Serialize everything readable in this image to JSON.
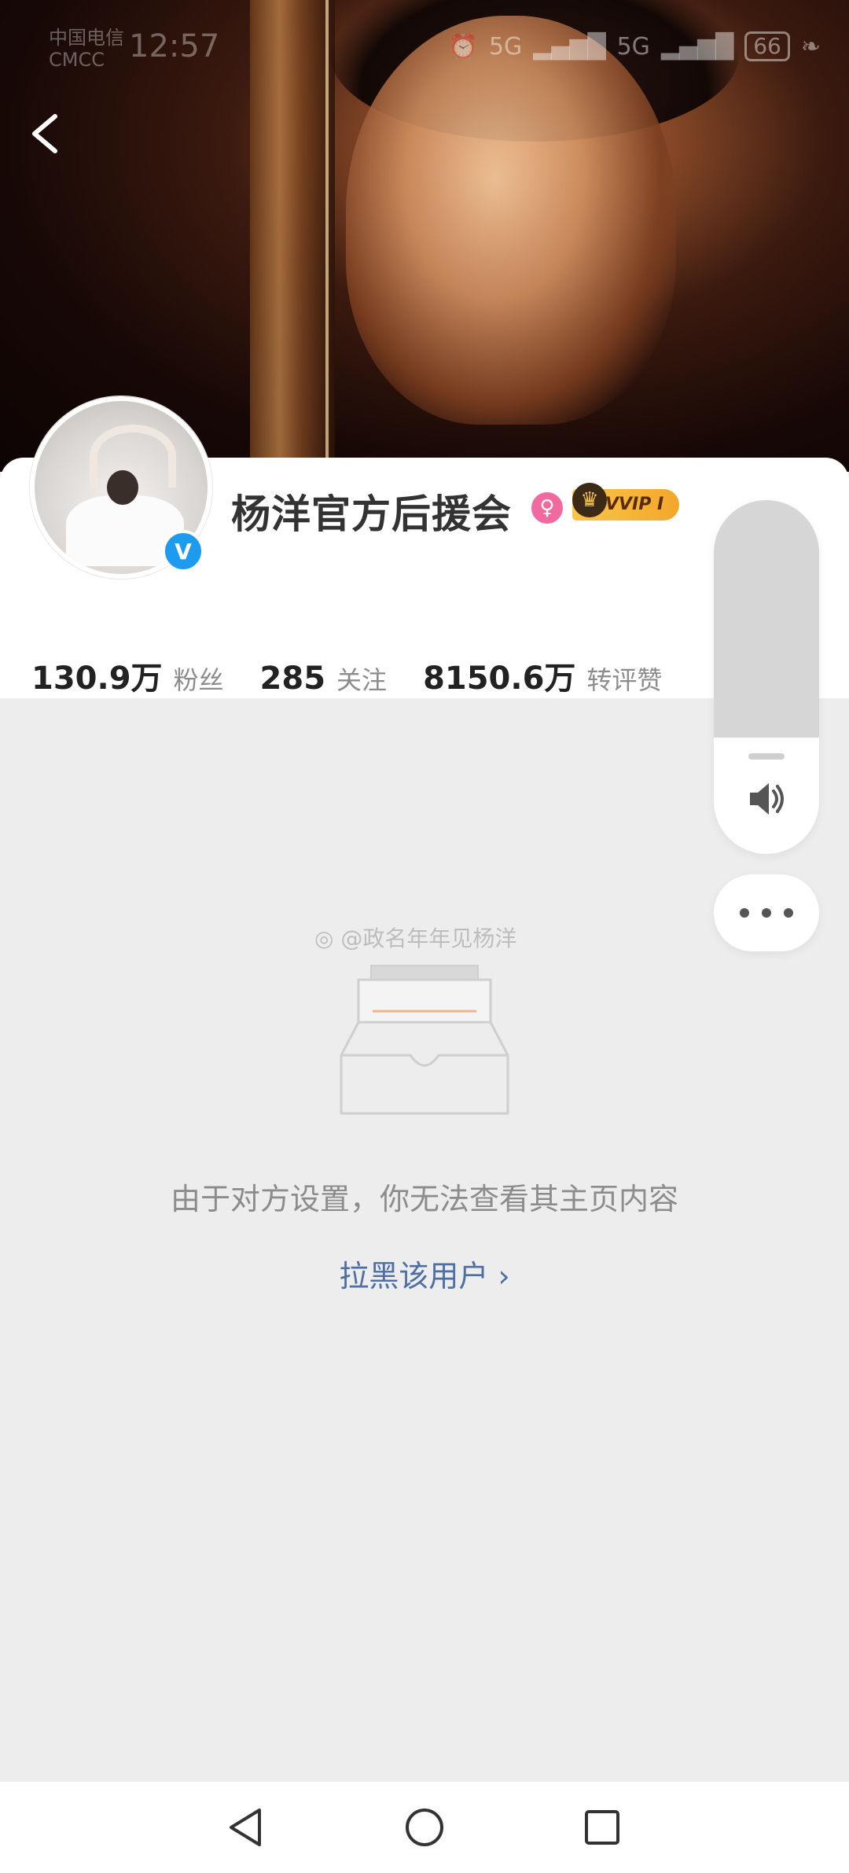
{
  "status_bar": {
    "carrier_line1": "中国电信",
    "carrier_line2": "CMCC",
    "time": "12:57",
    "signal_1": "5G",
    "signal_2": "5G",
    "battery": "66"
  },
  "profile": {
    "name": "杨洋官方后援会",
    "vip_label": "VVIP I",
    "verified_symbol": "V",
    "gender_symbol": "♀",
    "stats": [
      {
        "value": "130.9万",
        "label": "粉丝"
      },
      {
        "value": "285",
        "label": "关注"
      },
      {
        "value": "8150.6万",
        "label": "转评赞"
      }
    ]
  },
  "volume_level": 0.67,
  "content": {
    "watermark": "@政名年年见杨洋",
    "empty_message": "由于对方设置，你无法查看其主页内容",
    "block_link": "拉黑该用户 ›"
  },
  "colors": {
    "verified": "#1d9bf0",
    "vip_gold": "#f7c64b",
    "link_blue": "#4d6fa4",
    "background": "#ededed"
  },
  "icons": {
    "back": "chevron-left",
    "volume": "speaker",
    "more": "three-dots",
    "nav_back": "triangle",
    "nav_home": "circle",
    "nav_recents": "square"
  }
}
